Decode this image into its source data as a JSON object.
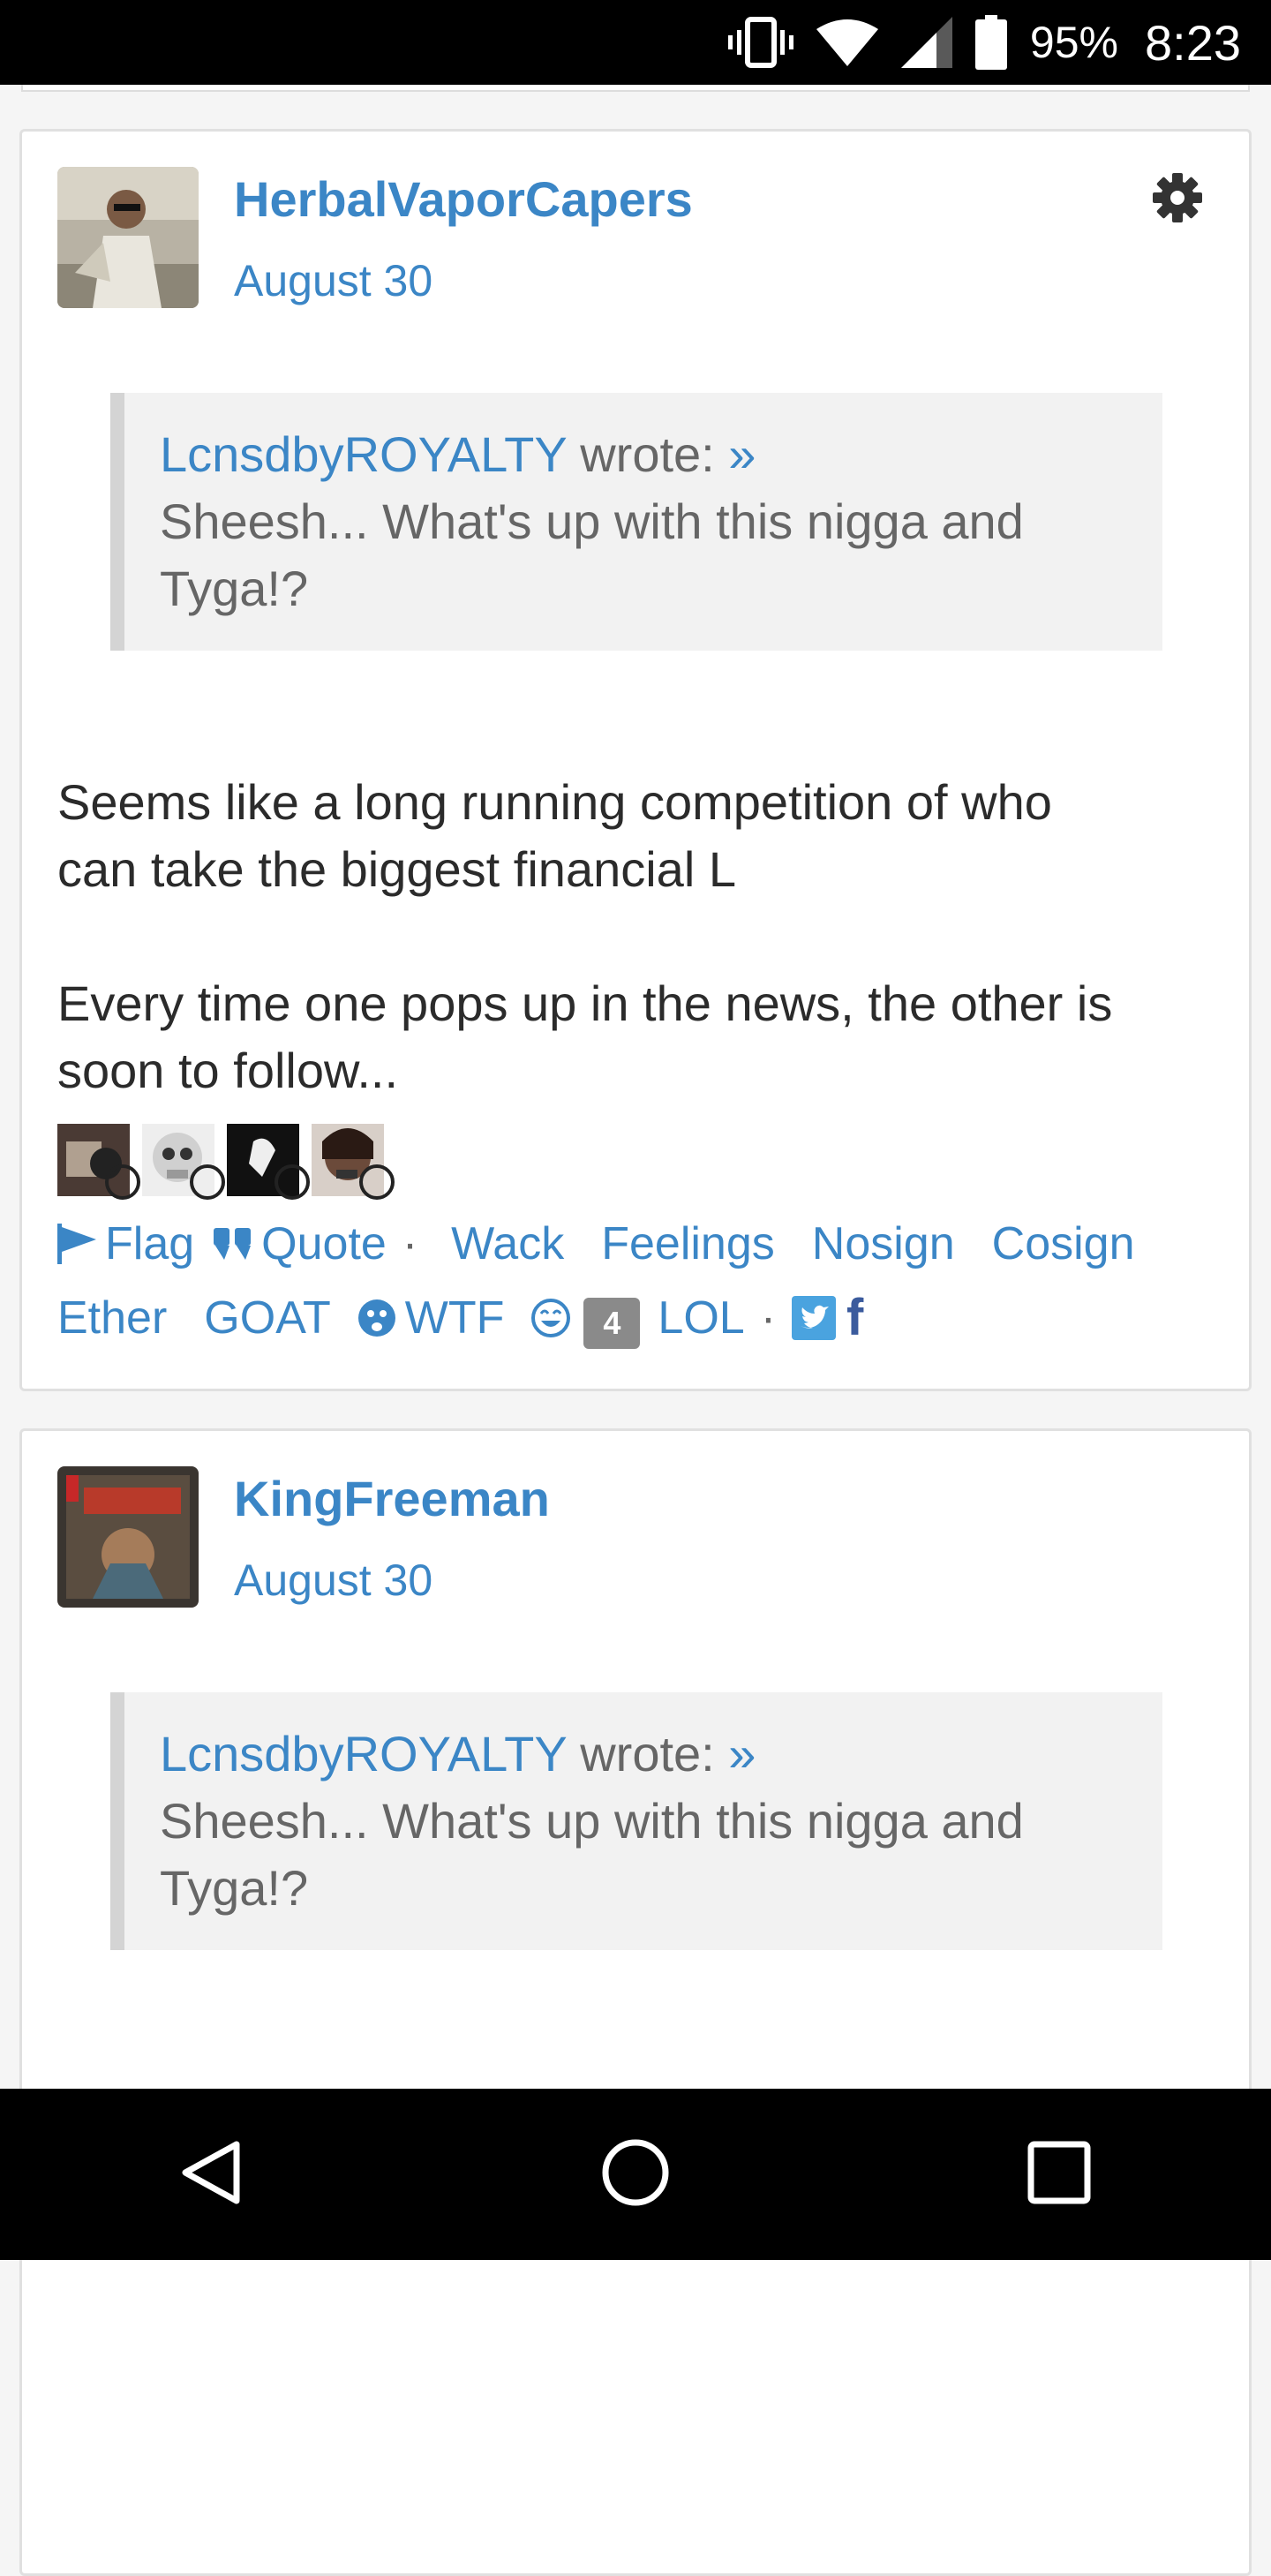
{
  "status_bar": {
    "battery_percent": "95%",
    "time": "8:23",
    "icons": [
      "vibrate-icon",
      "wifi-icon",
      "cell-signal-icon",
      "battery-icon"
    ]
  },
  "posts": [
    {
      "username": "HerbalVaporCapers",
      "date": "August 30",
      "quote": {
        "author": "LcnsdbyROYALTY",
        "wrote": "wrote:",
        "arrow": "»",
        "line1": "Sheesh... What's up with this nigga and",
        "line2": "Tyga!?"
      },
      "body_p1_line1": "Seems like a long running competition of who",
      "body_p1_line2": "can take the biggest financial L",
      "body_p2_line1": "Every time one pops up in the news, the other is",
      "body_p2_line2": "soon to follow...",
      "reactions": {
        "flag": "Flag",
        "quote": "Quote",
        "sep": "·",
        "wack": "Wack",
        "feelings": "Feelings",
        "nosign": "Nosign",
        "cosign": "Cosign",
        "ether": "Ether",
        "goat": "GOAT",
        "wtf": "WTF",
        "lol_count": "4",
        "lol": "LOL",
        "facebook": "f"
      }
    },
    {
      "username": "KingFreeman",
      "date": "August 30",
      "quote": {
        "author": "LcnsdbyROYALTY",
        "wrote": "wrote:",
        "arrow": "»",
        "line1": "Sheesh... What's up with this nigga and",
        "line2": "Tyga!?"
      }
    }
  ],
  "colors": {
    "link": "#3b86c6",
    "quote_bg": "#f2f2f2",
    "badge": "#8a8a8a"
  }
}
